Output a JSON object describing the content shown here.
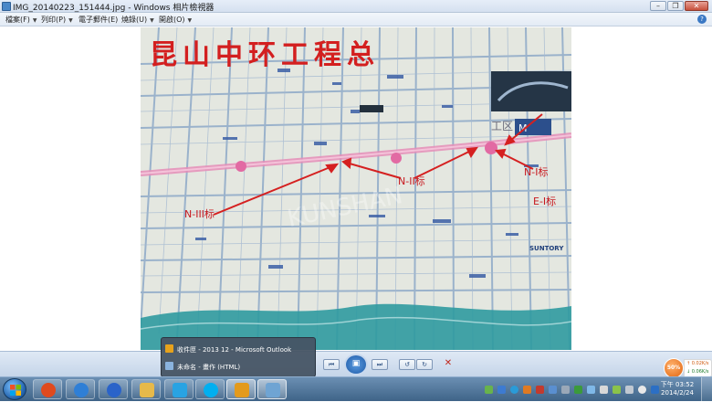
{
  "window": {
    "title": "IMG_20140223_151444.jpg - Windows 相片檢視器",
    "minimize_glyph": "–",
    "restore_glyph": "❐",
    "close_glyph": "✕"
  },
  "menu": {
    "items": [
      {
        "label": "檔案(F)"
      },
      {
        "label": "列印(P)"
      },
      {
        "label": "電子郵件(E)"
      },
      {
        "label": "燒錄(U)"
      },
      {
        "label": "開啟(O)"
      }
    ],
    "help_glyph": "?"
  },
  "photo": {
    "map_title": "昆山中环工程总",
    "labels": {
      "n1": "N-I标",
      "n2": "N-II标",
      "n3": "N-III标",
      "e1": "E-I标",
      "zone": "工区",
      "suntory": "SUNTORY",
      "m_sign": "M"
    },
    "colors": {
      "map_bg": "#dfe3dd",
      "road": "#8ea9c8",
      "main_road": "#e58db7",
      "river": "#2f9aa0",
      "title_red": "#d31f1f",
      "arrow_red": "#d52020",
      "building_blue": "#3c5fa6"
    }
  },
  "controls": {
    "prev_glyph": "⏮",
    "play_glyph": "▣",
    "next_glyph": "⏭",
    "rotate_ccw_glyph": "↺",
    "rotate_cw_glyph": "↻",
    "delete_glyph": "✕"
  },
  "taskbar_popup": {
    "items": [
      {
        "label": "收件匣 - 2013 12 - Microsoft Outlook",
        "icon": "outlook-icon"
      },
      {
        "label": "未命名 - 畫作 (HTML)",
        "icon": "paint-icon"
      }
    ]
  },
  "taskbar": {
    "pinned": [
      {
        "name": "media-player-icon",
        "color": "#e04a1e"
      },
      {
        "name": "internet-explorer-icon",
        "color": "#2f7fd6"
      },
      {
        "name": "sogou-icon",
        "color": "#2a63c9"
      },
      {
        "name": "file-explorer-icon",
        "color": "#e6b94a"
      },
      {
        "name": "qq-icon",
        "color": "#29a3e3"
      },
      {
        "name": "skype-icon",
        "color": "#00aff0"
      },
      {
        "name": "outlook-icon",
        "color": "#e39a1c"
      },
      {
        "name": "photo-viewer-icon",
        "color": "#6fa4d3"
      }
    ],
    "clock": {
      "time": "下午 03:52",
      "date": "2014/2/24"
    }
  },
  "network_widget": {
    "percent": "50%",
    "upload": "↑ 0.02K/s",
    "download": "↓ 0.06K/s"
  }
}
